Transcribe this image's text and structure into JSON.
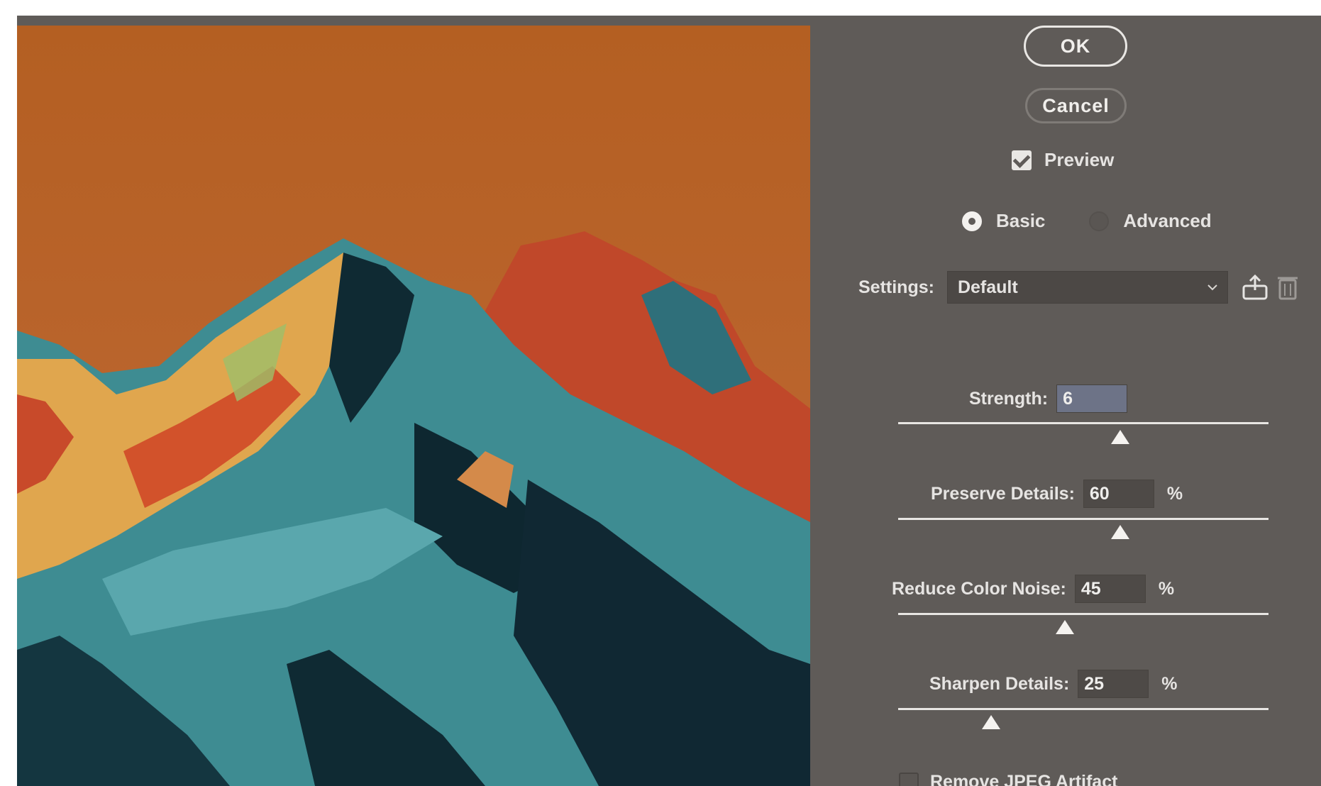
{
  "buttons": {
    "ok": "OK",
    "cancel": "Cancel"
  },
  "preview": {
    "label": "Preview",
    "checked": true
  },
  "modes": {
    "basic": "Basic",
    "advanced": "Advanced",
    "selected": "Basic"
  },
  "settings": {
    "label": "Settings:",
    "value": "Default"
  },
  "sliders": [
    {
      "label": "Strength:",
      "value": "6",
      "unit": "",
      "fraction": 0.6
    },
    {
      "label": "Preserve Details:",
      "value": "60",
      "unit": "%",
      "fraction": 0.6
    },
    {
      "label": "Reduce Color Noise:",
      "value": "45",
      "unit": "%",
      "fraction": 0.45
    },
    {
      "label": "Sharpen Details:",
      "value": "25",
      "unit": "%",
      "fraction": 0.25
    }
  ],
  "remove_jpeg": {
    "label": "Remove JPEG Artifact",
    "checked": false
  },
  "icons": {
    "save": "save-settings-icon",
    "delete": "trash-icon",
    "dropdown": "chevron-down-icon"
  }
}
